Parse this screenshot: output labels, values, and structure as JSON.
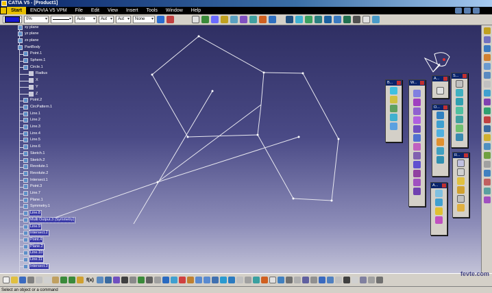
{
  "window": {
    "title": "CATIA V5 - [Product1]"
  },
  "menu": {
    "items": [
      "Start",
      "ENOVIA V5 VPM",
      "File",
      "Edit",
      "View",
      "Insert",
      "Tools",
      "Window",
      "Help"
    ]
  },
  "properties_toolbar": {
    "fill_color": "#1a1ad0",
    "transparency": "0%",
    "line_thickness": "Auto",
    "line_type": "Aut",
    "point_symbol": "Aut",
    "layer": "None"
  },
  "tree": {
    "nodes": [
      {
        "label": "xy plane",
        "icon": "plane-icon"
      },
      {
        "label": "yz plane",
        "icon": "plane-icon"
      },
      {
        "label": "zx plane",
        "icon": "plane-icon"
      },
      {
        "label": "PartBody",
        "icon": "body-icon"
      },
      {
        "label": "Point.1",
        "icon": "point-icon"
      },
      {
        "label": "Sphere.1",
        "icon": "sphere-icon"
      },
      {
        "label": "Circle.1",
        "icon": "circle-icon"
      },
      {
        "label": "Radius",
        "icon": "parameter-icon"
      },
      {
        "label": "X",
        "icon": "parameter-icon"
      },
      {
        "label": "Y",
        "icon": "parameter-icon"
      },
      {
        "label": "Z",
        "icon": "parameter-icon"
      },
      {
        "label": "Point.2",
        "icon": "point-icon"
      },
      {
        "label": "CircPattern.1",
        "icon": "pattern-icon"
      },
      {
        "label": "Line.1",
        "icon": "line-icon"
      },
      {
        "label": "Line.2",
        "icon": "line-icon"
      },
      {
        "label": "Line.3",
        "icon": "line-icon"
      },
      {
        "label": "Line.4",
        "icon": "line-icon"
      },
      {
        "label": "Line.5",
        "icon": "line-icon"
      },
      {
        "label": "Line.6",
        "icon": "line-icon"
      },
      {
        "label": "Sketch.1",
        "icon": "sketch-icon"
      },
      {
        "label": "Sketch.2",
        "icon": "sketch-icon"
      },
      {
        "label": "Revolute.1",
        "icon": "revolute-icon"
      },
      {
        "label": "Revolute.2",
        "icon": "revolute-icon"
      },
      {
        "label": "Intersect.1",
        "icon": "intersect-icon"
      },
      {
        "label": "Point.3",
        "icon": "point-icon"
      },
      {
        "label": "Line.7",
        "icon": "line-icon"
      },
      {
        "label": "Plane.1",
        "icon": "plane-icon"
      },
      {
        "label": "Symmetry.1",
        "icon": "symmetry-icon"
      },
      {
        "label": "Line.8",
        "icon": "line-icon"
      },
      {
        "label": "Multi Output.3 (Symmetry)",
        "icon": "multi-output-icon"
      },
      {
        "label": "Line.9",
        "icon": "line-icon"
      },
      {
        "label": "Intersect.2",
        "icon": "intersect-icon"
      },
      {
        "label": "Point.4",
        "icon": "point-icon"
      },
      {
        "label": "Plane.2",
        "icon": "plane-icon"
      },
      {
        "label": "Line.10",
        "icon": "line-icon"
      },
      {
        "label": "Line.11",
        "icon": "line-icon"
      },
      {
        "label": "Intersect.3",
        "icon": "intersect-icon"
      }
    ]
  },
  "palettes": [
    {
      "title": "B..."
    },
    {
      "title": "W..."
    },
    {
      "title": "A..."
    },
    {
      "title": "O..."
    },
    {
      "title": "S..."
    },
    {
      "title": "R..."
    },
    {
      "title": "A..."
    }
  ],
  "bottom_toolbar": {
    "formula_label": "f(x)"
  },
  "status": {
    "text": "Select an object or a command"
  },
  "watermark": {
    "text": "fevte.com"
  }
}
